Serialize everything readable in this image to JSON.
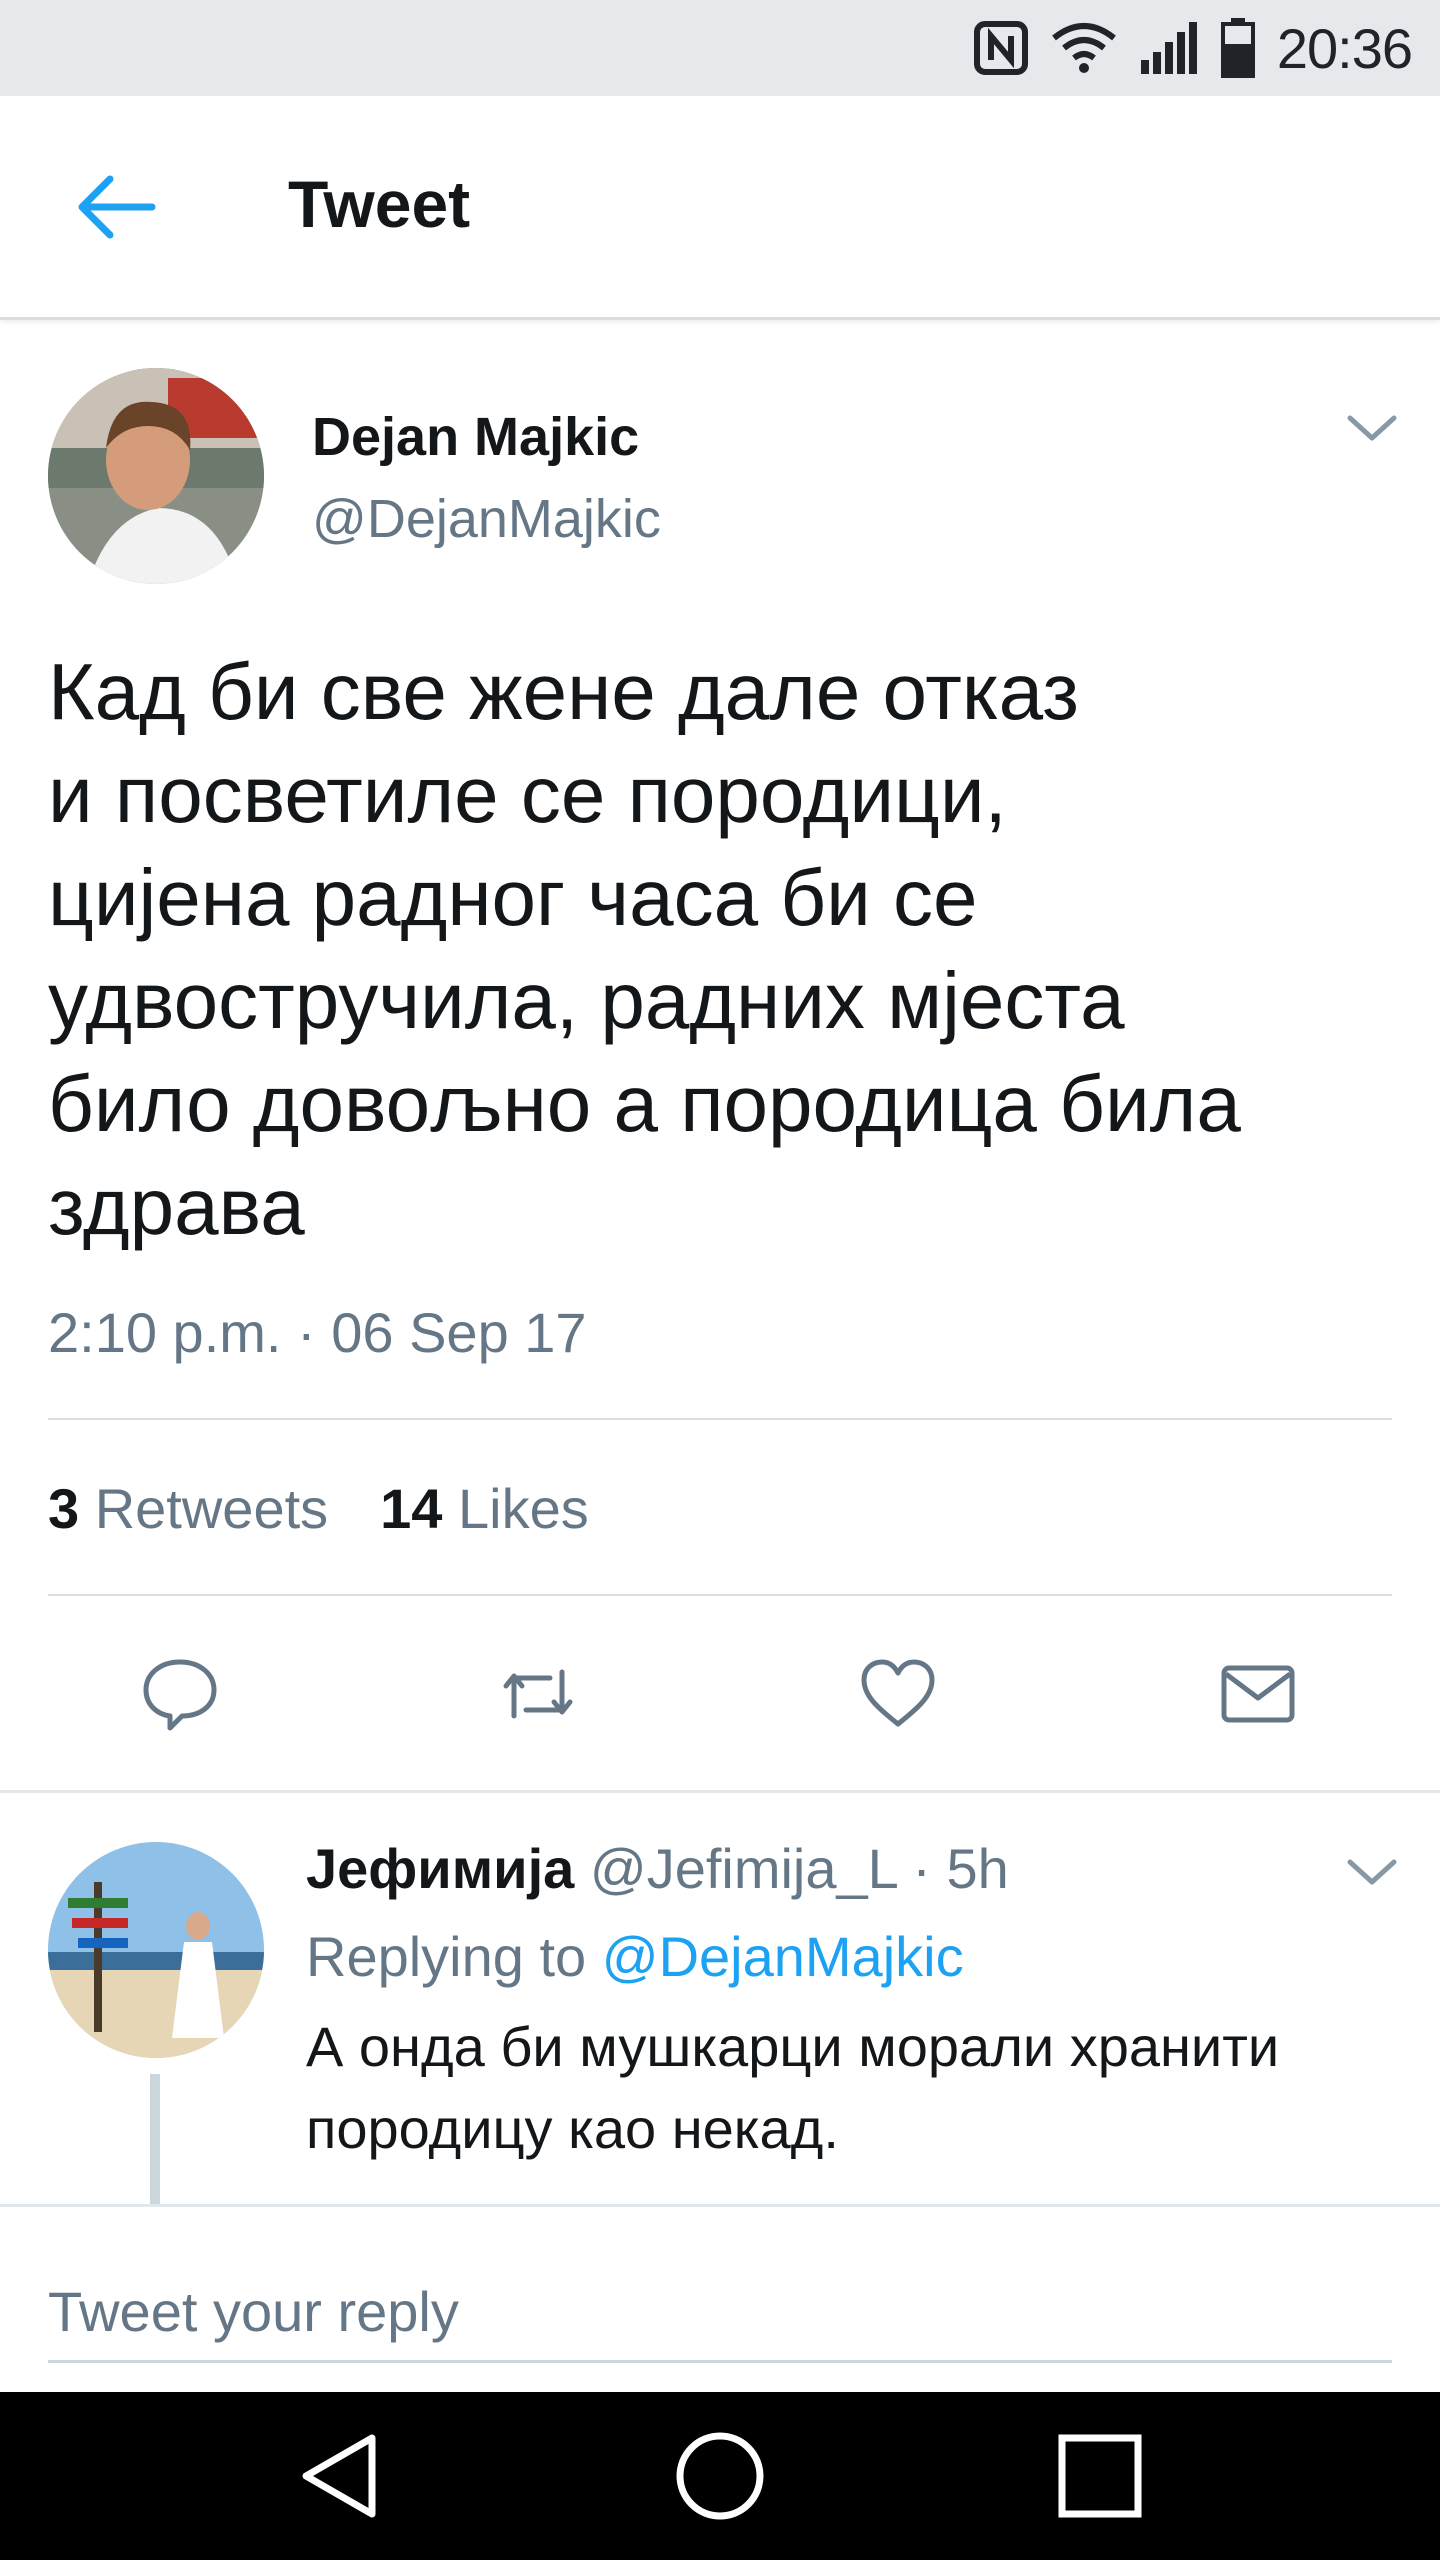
{
  "status_bar": {
    "time": "20:36",
    "icons": [
      "nfc-icon",
      "wifi-icon",
      "signal-icon",
      "battery-icon"
    ]
  },
  "header": {
    "title": "Tweet",
    "back_icon": "arrow-left-icon"
  },
  "tweet": {
    "author_name": "Dejan Majkic",
    "author_handle": "@DejanMajkic",
    "text": "Кад би све жене дале отказ\nи посветиле се породици,\nцијена радног часа би се\nудвостручила, радних мјеста\nбило довољно а породица била\nздрава",
    "timestamp": "2:10 p.m. · 06 Sep 17",
    "retweets_count": "3",
    "retweets_label": "Retweets",
    "likes_count": "14",
    "likes_label": "Likes",
    "actions": [
      "reply-icon",
      "retweet-icon",
      "like-icon",
      "direct-message-icon"
    ]
  },
  "reply": {
    "author_name": "Јефимија",
    "author_handle": "@Jefimija_L",
    "age": "5h",
    "replying_prefix": "Replying to",
    "replying_to": "@DejanMajkic",
    "text": "А онда би мушкарци морали хранити\nпородицу као некад."
  },
  "compose": {
    "placeholder": "Tweet your reply"
  },
  "colors": {
    "accent": "#1da1f2",
    "text_primary": "#14171a",
    "text_secondary": "#657786",
    "status_bar_bg": "#e6e9eb"
  }
}
